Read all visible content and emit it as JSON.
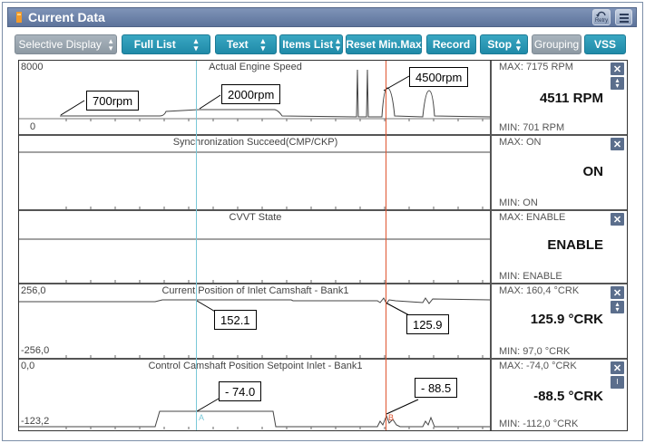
{
  "window": {
    "title": "Current Data",
    "retry_label": "Retry"
  },
  "toolbar": {
    "selective_display": "Selective Display",
    "full_list": "Full List",
    "text": "Text",
    "items_list": "Items List",
    "reset_min_max": "Reset Min.Max",
    "record": "Record",
    "stop": "Stop",
    "grouping": "Grouping",
    "vss": "VSS"
  },
  "panels": [
    {
      "title": "Actual Engine Speed",
      "y_max": "8000",
      "y_min": "0",
      "max_text": "MAX:  7175 RPM",
      "min_text": "MIN:  701 RPM",
      "current": "4511 RPM",
      "callouts": [
        "700rpm",
        "2000rpm",
        "4500rpm"
      ]
    },
    {
      "title": "Synchronization Succeed(CMP/CKP)",
      "max_text": "MAX: ON",
      "min_text": "MIN: ON",
      "current": "ON"
    },
    {
      "title": "CVVT State",
      "max_text": "MAX: ENABLE",
      "min_text": "MIN: ENABLE",
      "current": "ENABLE"
    },
    {
      "title": "Current Position of Inlet Camshaft - Bank1",
      "y_max": "256,0",
      "y_min": "-256,0",
      "max_text": "MAX: 160,4 °CRK",
      "min_text": "MIN:  97,0 °CRK",
      "current": "125.9 °CRK",
      "callouts": [
        "152.1",
        "125.9"
      ]
    },
    {
      "title": "Control Camshaft Position Setpoint Inlet - Bank1",
      "y_max": "0,0",
      "y_min": "-123,2",
      "max_text": "MAX: -74,0 °CRK",
      "min_text": "MIN: -112,0 °CRK",
      "current": "-88.5 °CRK",
      "callouts": [
        "- 74.0",
        "- 88.5"
      ]
    }
  ],
  "cursors": {
    "a_label": "A",
    "b_label": "B"
  },
  "colors": {
    "cursor_a": "#79c8d8",
    "cursor_b": "#e05530",
    "button": "#2795b3",
    "titlebar": "#6e84ab"
  },
  "icons": {
    "close": "close-icon",
    "scroll": "updown-icon",
    "menu": "menu-icon",
    "retry": "retry-icon"
  }
}
